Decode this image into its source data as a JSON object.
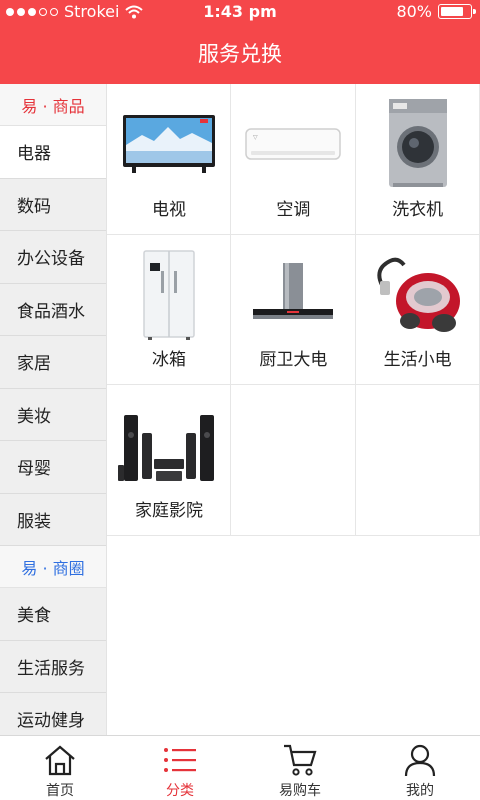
{
  "status_bar": {
    "carrier": "Strokei",
    "time": "1:43 pm",
    "battery": "80%"
  },
  "header": {
    "title": "服务兑换"
  },
  "sidebar": {
    "sections": [
      {
        "title": "易 · 商品",
        "color": "#e5333a",
        "items": [
          "电器",
          "数码",
          "办公设备",
          "食品酒水",
          "家居",
          "美妆",
          "母婴",
          "服装"
        ]
      },
      {
        "title": "易 · 商圈",
        "color": "#2f6fe0",
        "items": [
          "美食",
          "生活服务",
          "运动健身"
        ]
      }
    ],
    "active_item": "电器"
  },
  "products": [
    {
      "label": "电视",
      "icon": "tv-icon"
    },
    {
      "label": "空调",
      "icon": "air-conditioner-icon"
    },
    {
      "label": "洗衣机",
      "icon": "washing-machine-icon"
    },
    {
      "label": "冰箱",
      "icon": "refrigerator-icon"
    },
    {
      "label": "厨卫大电",
      "icon": "range-hood-icon"
    },
    {
      "label": "生活小电",
      "icon": "vacuum-cleaner-icon"
    },
    {
      "label": "家庭影院",
      "icon": "home-theater-icon"
    }
  ],
  "bottom_nav": [
    {
      "label": "首页",
      "icon": "home-icon",
      "active": false
    },
    {
      "label": "分类",
      "icon": "category-list-icon",
      "active": true
    },
    {
      "label": "易购车",
      "icon": "shopping-cart-icon",
      "active": false
    },
    {
      "label": "我的",
      "icon": "user-icon",
      "active": false
    }
  ],
  "colors": {
    "brand": "#f5474a",
    "active_text": "#e5333a",
    "section_blue": "#2f6fe0"
  }
}
